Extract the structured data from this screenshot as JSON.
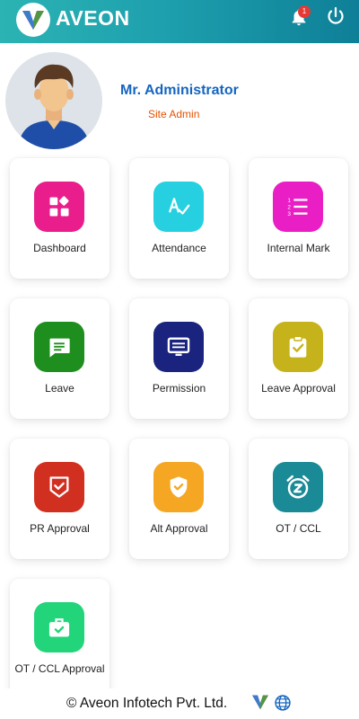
{
  "header": {
    "brand": "AVEON",
    "notification_count": "1",
    "colors": {
      "gradient_start": "#2bb3b3",
      "gradient_end": "#0e7f97"
    }
  },
  "profile": {
    "name": "Mr. Administrator",
    "role": "Site Admin"
  },
  "menu": [
    {
      "label": "Dashboard",
      "icon": "dashboard-icon",
      "color": "#e91e8c"
    },
    {
      "label": "Attendance",
      "icon": "attendance-icon",
      "color": "#26d0e0"
    },
    {
      "label": "Internal Mark",
      "icon": "list-icon",
      "color": "#e91ec4"
    },
    {
      "label": "Leave",
      "icon": "message-icon",
      "color": "#1e8e1e"
    },
    {
      "label": "Permission",
      "icon": "monitor-icon",
      "color": "#1a237e"
    },
    {
      "label": "Leave Approval",
      "icon": "clipboard-check-icon",
      "color": "#c6b21a"
    },
    {
      "label": "PR Approval",
      "icon": "shield-check-icon",
      "color": "#d12f1f"
    },
    {
      "label": "Alt Approval",
      "icon": "shield-check-icon",
      "color": "#f5a623"
    },
    {
      "label": "OT / CCL",
      "icon": "alarm-z-icon",
      "color": "#1a8a96"
    },
    {
      "label": "OT / CCL Approval",
      "icon": "briefcase-check-icon",
      "color": "#22d47a"
    }
  ],
  "footer": {
    "copyright": "© Aveon Infotech Pvt. Ltd."
  }
}
